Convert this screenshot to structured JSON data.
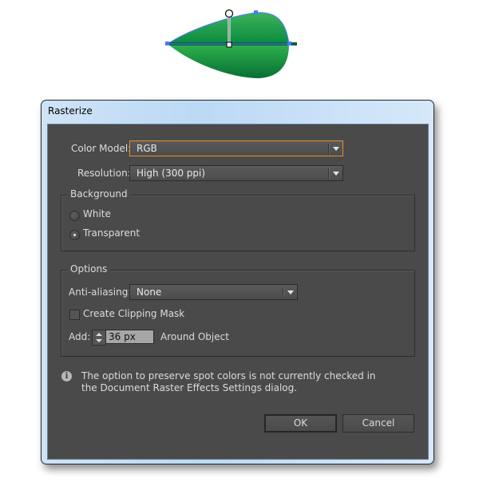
{
  "artwork": {
    "name": "leaf-shape",
    "colors": {
      "fill_light": "#3db35a",
      "fill_dark": "#0a7a3a",
      "vein": "#0b5e4a",
      "selection": "#4a7bff"
    }
  },
  "dialog": {
    "title": "Rasterize",
    "color_model": {
      "label": "Color Model:",
      "value": "RGB"
    },
    "resolution": {
      "label": "Resolution:",
      "value": "High (300 ppi)"
    },
    "background": {
      "title": "Background",
      "options": [
        {
          "label": "White",
          "selected": false
        },
        {
          "label": "Transparent",
          "selected": true
        }
      ]
    },
    "options": {
      "title": "Options",
      "anti_aliasing": {
        "label": "Anti-aliasing:",
        "value": "None"
      },
      "clipping_mask": {
        "label": "Create Clipping Mask",
        "checked": false
      },
      "add": {
        "label": "Add:",
        "value": "36 px",
        "suffix": "Around Object"
      }
    },
    "info": {
      "icon": "info-icon",
      "message": "The option to preserve spot colors is not currently checked in the Document Raster Effects Settings dialog."
    },
    "buttons": {
      "ok": "OK",
      "cancel": "Cancel"
    },
    "accent_color": "#e8902a"
  }
}
